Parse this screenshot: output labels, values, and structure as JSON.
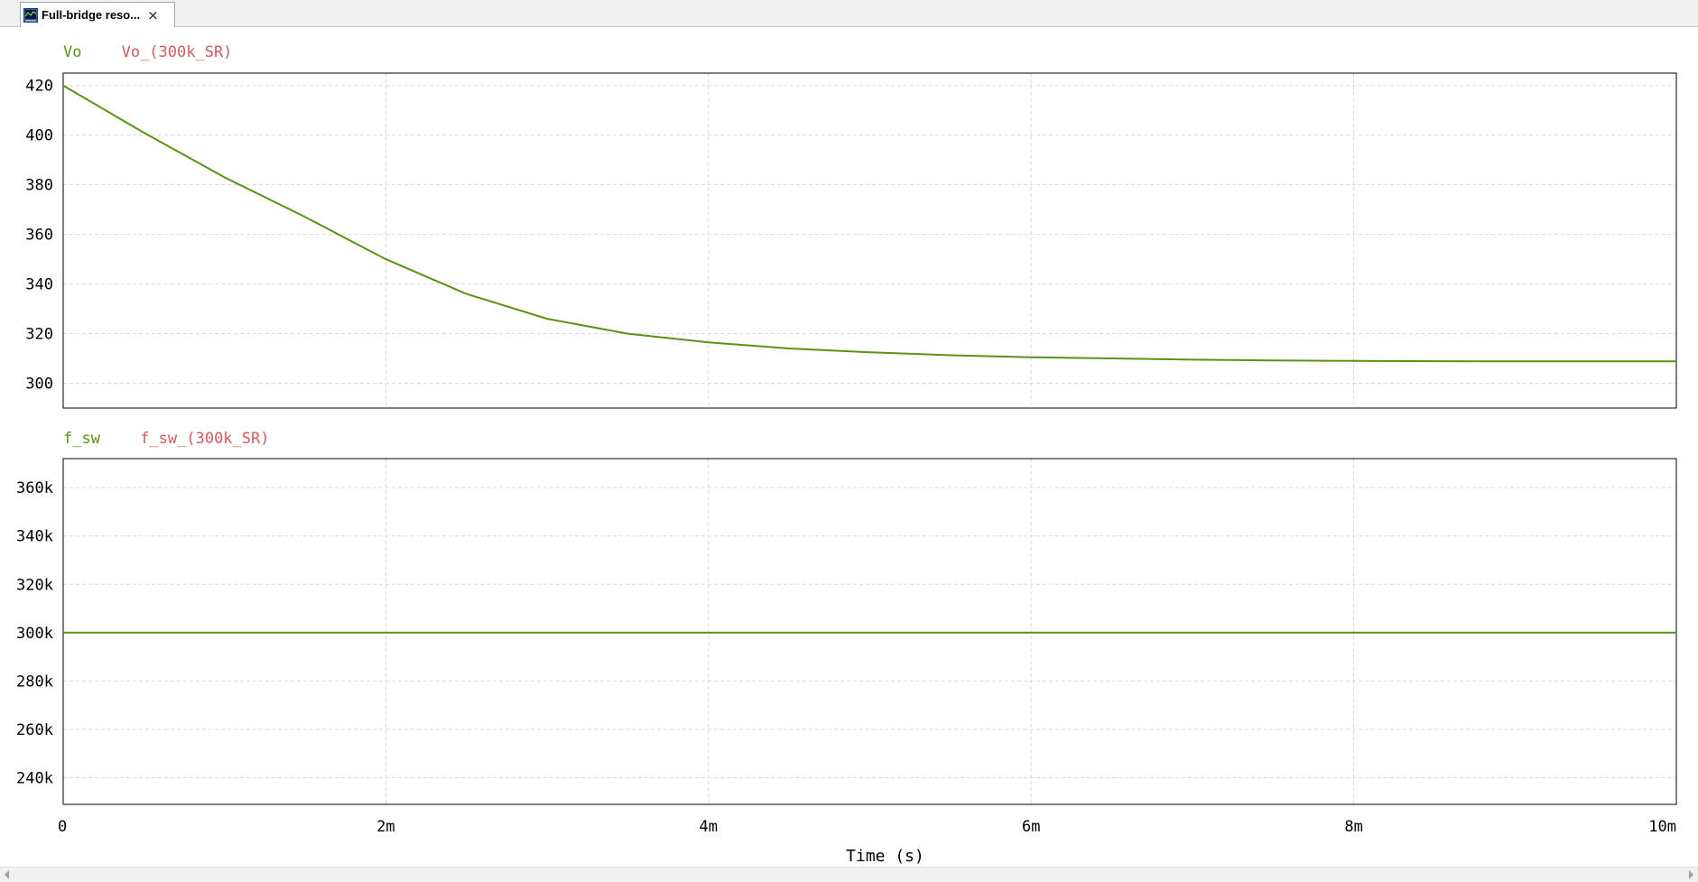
{
  "tab": {
    "title": "Full-bridge reso...",
    "close": "×"
  },
  "colors": {
    "series_a": "#5a9216",
    "series_b": "#cd5c5c",
    "grid": "#d9d9d9",
    "axis": "#000000"
  },
  "chart_data": [
    {
      "type": "line",
      "ylim": [
        290,
        425
      ],
      "yticks": [
        300,
        320,
        340,
        360,
        380,
        400,
        420
      ],
      "ytick_labels": [
        "300",
        "320",
        "340",
        "360",
        "380",
        "400",
        "420"
      ],
      "xlim": [
        0,
        0.01
      ],
      "grid": true,
      "legend_placement": "top-left",
      "series": [
        {
          "name": "Vo",
          "color": "#5a9216",
          "x": [
            0,
            0.0005,
            0.001,
            0.0015,
            0.002,
            0.0025,
            0.003,
            0.0035,
            0.004,
            0.0045,
            0.005,
            0.0055,
            0.006,
            0.0065,
            0.007,
            0.0075,
            0.008,
            0.0085,
            0.009,
            0.0095,
            0.01
          ],
          "y": [
            420,
            401,
            383,
            367,
            350,
            336,
            326,
            320,
            316.5,
            314,
            312.5,
            311.3,
            310.5,
            310,
            309.5,
            309.2,
            309,
            308.9,
            308.8,
            308.8,
            308.8
          ]
        },
        {
          "name": "Vo_(300k_SR)",
          "color": "#cd5c5c",
          "x": [],
          "y": []
        }
      ]
    },
    {
      "type": "line",
      "ylim": [
        229000,
        372000
      ],
      "yticks": [
        240000,
        260000,
        280000,
        300000,
        320000,
        340000,
        360000
      ],
      "ytick_labels": [
        "240k",
        "260k",
        "280k",
        "300k",
        "320k",
        "340k",
        "360k"
      ],
      "xlim": [
        0,
        0.01
      ],
      "xticks": [
        0,
        0.002,
        0.004,
        0.006,
        0.008,
        0.01
      ],
      "xtick_labels": [
        "0",
        "2m",
        "4m",
        "6m",
        "8m",
        "10m"
      ],
      "xlabel": "Time (s)",
      "grid": true,
      "legend_placement": "top-left",
      "series": [
        {
          "name": "f_sw",
          "color": "#5a9216",
          "x": [
            0,
            0.01
          ],
          "y": [
            300000,
            300000
          ]
        },
        {
          "name": "f_sw_(300k_SR)",
          "color": "#cd5c5c",
          "x": [],
          "y": []
        }
      ]
    }
  ]
}
